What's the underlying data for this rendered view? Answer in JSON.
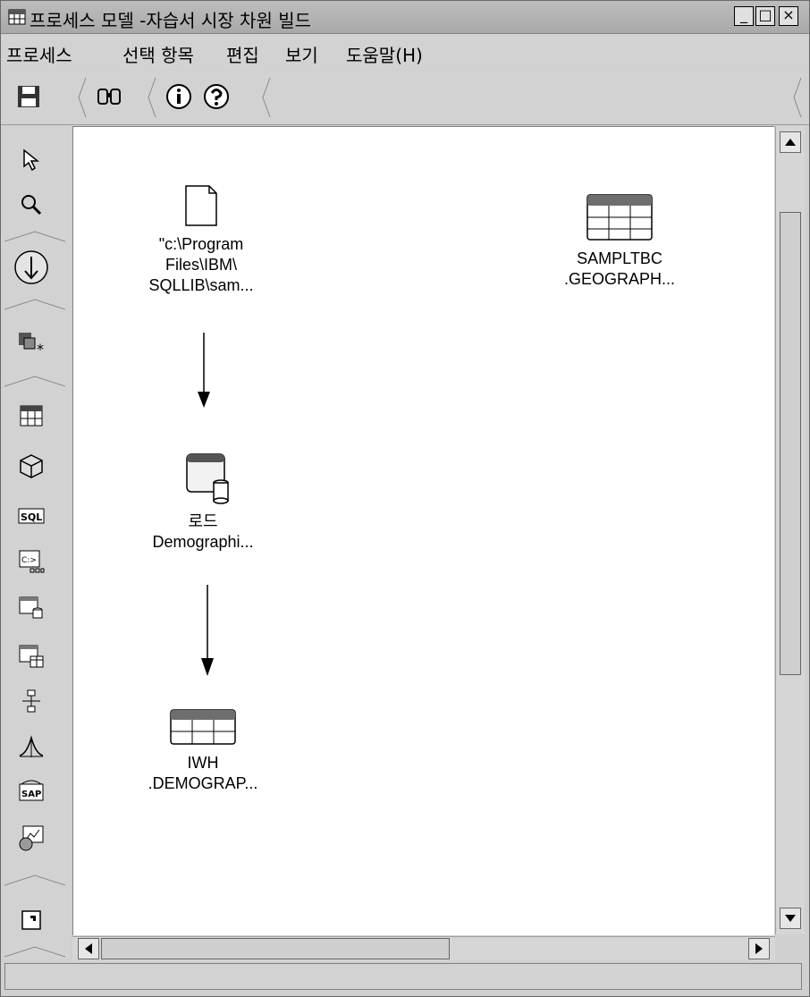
{
  "window": {
    "title": "프로세스 모델 -자습서 시장 차원 빌드",
    "buttons": {
      "minimize": "_",
      "maximize": "□",
      "close": "×"
    }
  },
  "menu": [
    "프로세스",
    "선택 항목",
    "편집",
    "보기",
    "도움말(H)"
  ],
  "toolbar": [
    "save-icon",
    "find-icon",
    "info-icon",
    "help-icon"
  ],
  "palette": [
    "pointer-icon",
    "zoom-icon",
    "task-flow-icon",
    "new-object-icon",
    "table-icon",
    "cube-icon",
    "sql-icon",
    "program-icon",
    "file-load-icon",
    "table-load-icon",
    "transform-icon",
    "statistics-icon",
    "sap-icon",
    "web-icon",
    "shortcut-icon"
  ],
  "nodes": {
    "file": {
      "lines": [
        "\"c:\\Program",
        "Files\\IBM\\",
        "SQLLIB\\sam..."
      ]
    },
    "step": {
      "lines": [
        "로드",
        "Demographi..."
      ]
    },
    "target_table": {
      "lines": [
        "IWH",
        ".DEMOGRAP..."
      ]
    },
    "source_table": {
      "lines": [
        "SAMPLTBC",
        ".GEOGRAPH..."
      ]
    }
  },
  "colors": {
    "canvas": "#ffffff",
    "chrome": "#d2d2d2",
    "table_header": "#6e6e6e"
  }
}
